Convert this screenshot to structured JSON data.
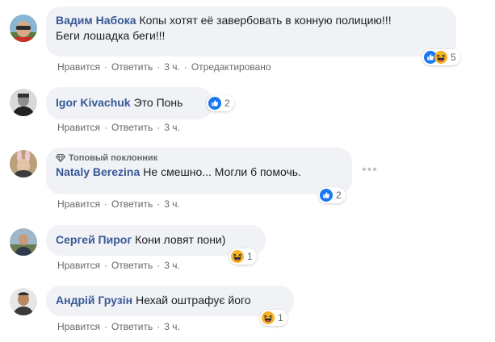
{
  "colors": {
    "author": "#385898",
    "bubble": "#f0f2f5",
    "meta": "#65676b",
    "like": "#1877f2",
    "haha": "#f7b125"
  },
  "action_labels": {
    "like": "Нравится",
    "reply": "Ответить"
  },
  "comments": [
    {
      "author": "Вадим Набока",
      "text_line1": "Копы хотят её завербовать в конную полицию!!!",
      "text_line2": "Беги лошадка беги!!!",
      "time": "3 ч.",
      "edited": "Отредактировано",
      "reaction_icons": [
        "like-icon",
        "haha-icon"
      ],
      "reaction_count": "5"
    },
    {
      "author": "Igor Kivachuk",
      "text": "Это Понь",
      "time": "3 ч.",
      "reaction_icons": [
        "like-icon"
      ],
      "reaction_count": "2"
    },
    {
      "badge": "Топовый поклонник",
      "badge_icon": "diamond-icon",
      "author": "Nataly Berezina",
      "text": "Не смешно... Могли б помочь.",
      "time": "3 ч.",
      "reaction_icons": [
        "like-icon"
      ],
      "reaction_count": "2",
      "more_icon": "more-options-icon"
    },
    {
      "author": "Сергей Пирог",
      "text": "Кони ловят пони)",
      "time": "3 ч.",
      "reaction_icons": [
        "haha-icon"
      ],
      "reaction_count": "1"
    },
    {
      "author": "Андрій Грузін",
      "text": "Нехай оштрафує його",
      "time": "3 ч.",
      "reaction_icons": [
        "haha-icon"
      ],
      "reaction_count": "1"
    }
  ]
}
